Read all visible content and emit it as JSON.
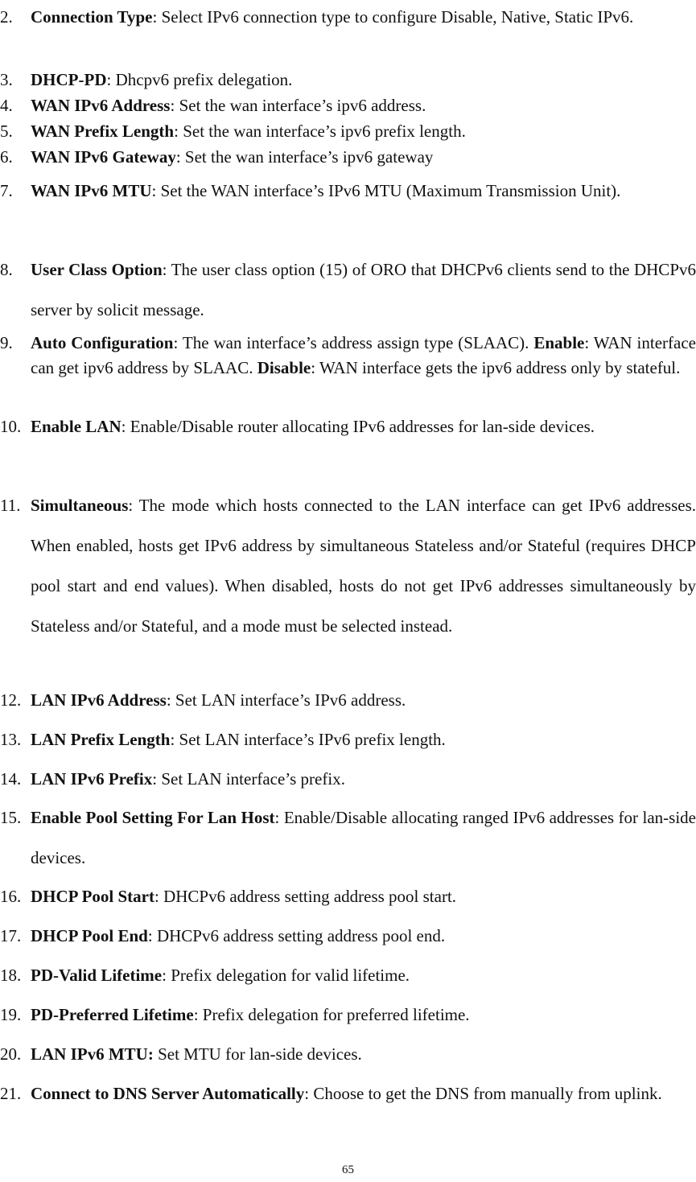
{
  "items": [
    {
      "num": "2.",
      "term": "Connection Type",
      "sep": ": ",
      "desc": "Select IPv6 connection type to configure Disable, Native, Static IPv6."
    },
    {
      "num": "3.",
      "term": "DHCP-PD",
      "sep": ": ",
      "desc": "Dhcpv6 prefix delegation."
    },
    {
      "num": "4.",
      "term": "WAN IPv6 Address",
      "sep": ": ",
      "desc": "Set the wan interface’s ipv6 address."
    },
    {
      "num": "5.",
      "term": "WAN Prefix Length",
      "sep": ": ",
      "desc": "Set the wan interface’s ipv6 prefix length."
    },
    {
      "num": "6.",
      "term": "WAN IPv6 Gateway",
      "sep": ": ",
      "desc": "Set the wan interface’s ipv6 gateway"
    },
    {
      "num": "7.",
      "term": "WAN IPv6 MTU",
      "sep": ": ",
      "desc": "Set the WAN interface’s IPv6 MTU (Maximum Transmission Unit)."
    },
    {
      "num": "8.",
      "term": "User Class Option",
      "sep": ": ",
      "desc": "The user class option (15) of ORO that DHCPv6 clients send to the DHCPv6 server by solicit message."
    },
    {
      "num": "9.",
      "term": "Auto Configuration",
      "sep": ": ",
      "desc": "The wan interface’s address assign type (SLAAC). ",
      "term2": "Enable",
      "desc2": ": WAN interface can get ipv6 address by SLAAC. ",
      "term3": "Disable",
      "desc3": ": WAN interface gets the ipv6 address only by stateful."
    },
    {
      "num": "10.",
      "term": "Enable LAN",
      "sep": ": ",
      "desc": "Enable/Disable router allocating IPv6 addresses for lan-side devices."
    },
    {
      "num": "11.",
      "term": "Simultaneous",
      "sep": ": ",
      "desc": "The mode which hosts connected to the LAN interface can get IPv6 addresses. When enabled, hosts get IPv6 address by simultaneous Stateless and/or Stateful (requires DHCP pool start and end values). When disabled, hosts do not get IPv6 addresses simultaneously by Stateless and/or Stateful, and a mode must be selected instead."
    },
    {
      "num": "12.",
      "term": "LAN IPv6 Address",
      "sep": ": ",
      "desc": "Set LAN interface’s IPv6 address."
    },
    {
      "num": "13.",
      "term": "LAN Prefix Length",
      "sep": ": ",
      "desc": "Set LAN interface’s IPv6 prefix length."
    },
    {
      "num": "14.",
      "term": "LAN IPv6 Prefix",
      "sep": ": ",
      "desc": "Set LAN interface’s prefix."
    },
    {
      "num": "15.",
      "term": "Enable Pool Setting For Lan Host",
      "sep": ": ",
      "desc": "Enable/Disable allocating ranged IPv6 addresses for lan-side devices."
    },
    {
      "num": "16.",
      "term": "DHCP Pool Start",
      "sep": ": ",
      "desc": "DHCPv6 address setting address pool start."
    },
    {
      "num": "17.",
      "term": "DHCP Pool End",
      "sep": ": ",
      "desc": "DHCPv6 address setting address pool end."
    },
    {
      "num": "18.",
      "term": "PD-Valid Lifetime",
      "sep": ": ",
      "desc": "Prefix delegation for valid lifetime."
    },
    {
      "num": "19.",
      "term": "PD-Preferred Lifetime",
      "sep": ": ",
      "desc": "Prefix delegation for preferred lifetime."
    },
    {
      "num": "20.",
      "term": "LAN IPv6 MTU:",
      "sep": " ",
      "desc": "Set MTU for lan-side devices."
    },
    {
      "num": "21.",
      "term": "Connect to DNS Server Automatically",
      "sep": ": ",
      "desc": "Choose to get the DNS from manually from uplink."
    }
  ],
  "page_number": "65"
}
